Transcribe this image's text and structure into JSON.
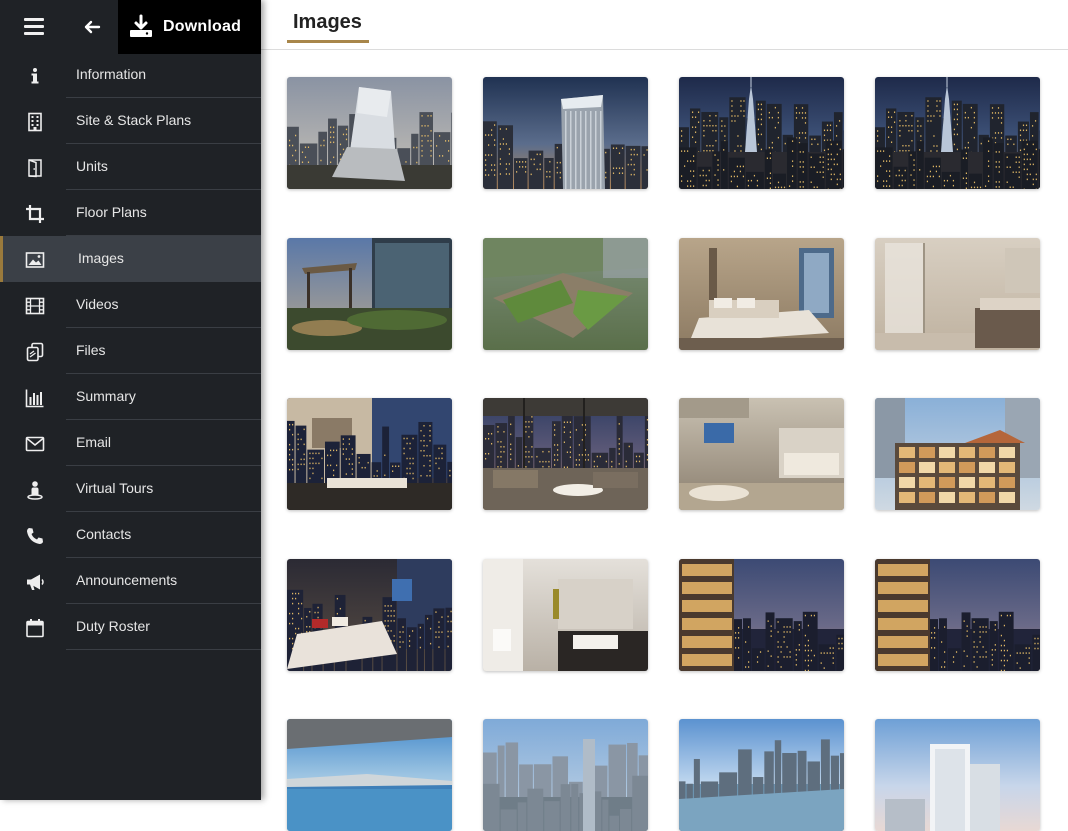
{
  "toolbar": {
    "download_label": "Download"
  },
  "sidebar": {
    "items": [
      {
        "label": "Information",
        "icon": "info-icon"
      },
      {
        "label": "Site & Stack Plans",
        "icon": "building-icon"
      },
      {
        "label": "Units",
        "icon": "door-icon"
      },
      {
        "label": "Floor Plans",
        "icon": "crop-icon"
      },
      {
        "label": "Images",
        "icon": "image-icon",
        "active": true
      },
      {
        "label": "Videos",
        "icon": "film-icon"
      },
      {
        "label": "Files",
        "icon": "files-icon"
      },
      {
        "label": "Summary",
        "icon": "bar-chart-icon"
      },
      {
        "label": "Email",
        "icon": "envelope-icon"
      },
      {
        "label": "Virtual Tours",
        "icon": "person-pin-icon"
      },
      {
        "label": "Contacts",
        "icon": "phone-icon"
      },
      {
        "label": "Announcements",
        "icon": "megaphone-icon"
      },
      {
        "label": "Duty Roster",
        "icon": "calendar-icon"
      }
    ]
  },
  "main": {
    "title": "Images",
    "accent_color": "#a8864a",
    "images": [
      {
        "subject": "tower-aerial-dusk"
      },
      {
        "subject": "tower-exterior-dusk"
      },
      {
        "subject": "city-skyline-night"
      },
      {
        "subject": "city-skyline-night"
      },
      {
        "subject": "rooftop-garden-evening"
      },
      {
        "subject": "sky-garden-aerial"
      },
      {
        "subject": "bedroom-interior"
      },
      {
        "subject": "bathroom-interior"
      },
      {
        "subject": "bedroom-study-night"
      },
      {
        "subject": "living-room-sunset"
      },
      {
        "subject": "living-kitchen-interior"
      },
      {
        "subject": "building-section-cutaway"
      },
      {
        "subject": "master-bedroom-night"
      },
      {
        "subject": "bathroom-marble"
      },
      {
        "subject": "balcony-city-night"
      },
      {
        "subject": "balcony-city-night"
      },
      {
        "subject": "infinity-pool-sea-view"
      },
      {
        "subject": "city-aerial-day"
      },
      {
        "subject": "coastline-day"
      },
      {
        "subject": "tower-day-sky"
      }
    ]
  }
}
